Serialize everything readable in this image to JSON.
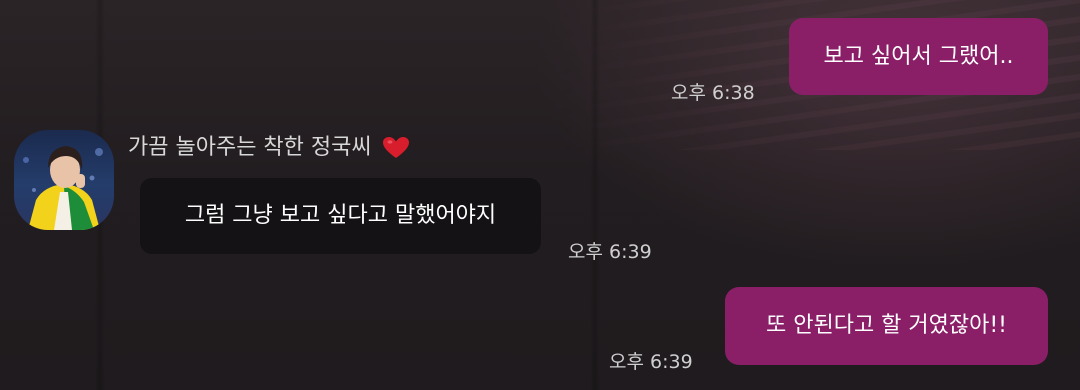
{
  "chat": {
    "messages": [
      {
        "direction": "outgoing",
        "text": "보고 싶어서 그랬어..",
        "time": "오후 6:38"
      },
      {
        "direction": "incoming",
        "sender": "가끔 놀아주는 착한 정국씨",
        "sender_emoji_icon": "heart-icon",
        "text": "그럼 그냥 보고 싶다고 말했어야지",
        "time": "오후 6:39"
      },
      {
        "direction": "outgoing",
        "text": "또 안된다고 할 거였잖아!!",
        "time": "오후 6:39"
      }
    ]
  },
  "colors": {
    "outgoing_bubble": "#8a1f68",
    "incoming_bubble": "#141214",
    "background": "#262023",
    "heart": "#d81d2c"
  }
}
